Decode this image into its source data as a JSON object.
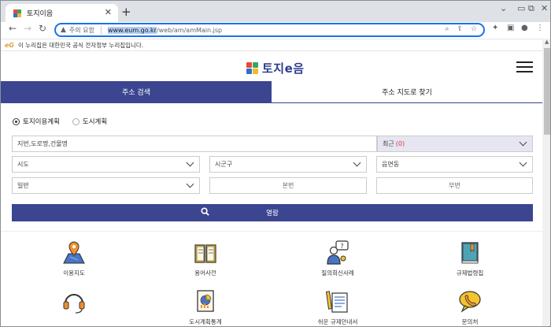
{
  "browser": {
    "tab_title": "토지이음",
    "tab_close": "✕",
    "new_tab": "+",
    "security_label": "주의 요함",
    "url_host": "www.eum.go.kr",
    "url_path": "/web/am/amMain.jsp"
  },
  "gov_banner": {
    "logo": "eG",
    "text": "이 누리집은 대한민국 공식 전자정부 누리집입니다."
  },
  "header": {
    "logo_text": "토지e음"
  },
  "tabs": [
    {
      "label": "주소 검색",
      "active": true
    },
    {
      "label": "주소 지도로 찾기",
      "active": false
    }
  ],
  "search": {
    "radio_options": [
      {
        "label": "토지이용계획",
        "checked": true
      },
      {
        "label": "도시계획",
        "checked": false
      }
    ],
    "address_placeholder": "지번,도로명,건물명",
    "recent_label": "최근",
    "recent_count": "(0)",
    "sido": "시도",
    "sigungu": "시군구",
    "eupmyeondong": "읍면동",
    "land_type": "일반",
    "main_number_placeholder": "본번",
    "sub_number_placeholder": "부번",
    "submit_label": "열람"
  },
  "services": [
    {
      "label": "이용지도"
    },
    {
      "label": "용어사전"
    },
    {
      "label": "질의회신사례"
    },
    {
      "label": "규제법령집"
    },
    {
      "label": ""
    },
    {
      "label": "도시계획통계"
    },
    {
      "label": "쉬운 규제안내서"
    },
    {
      "label": "문의처"
    }
  ],
  "colors": {
    "brand_navy": "#3b4590",
    "omnibox_focus": "#1a73e8",
    "recent_count": "#d9342b"
  }
}
